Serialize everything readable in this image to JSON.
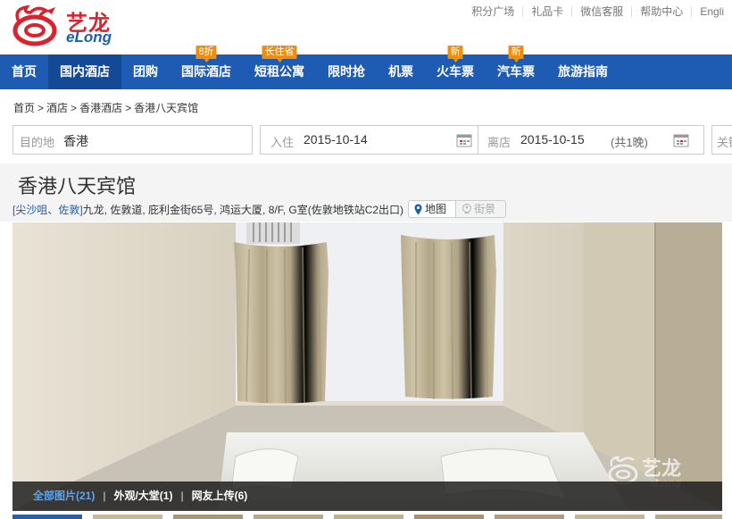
{
  "brand": {
    "name_cn": "艺龙",
    "name_en": "eLong"
  },
  "toplinks": [
    "积分广场",
    "礼品卡",
    "微信客服",
    "帮助中心",
    "Engli"
  ],
  "nav": [
    {
      "label": "首页"
    },
    {
      "label": "国内酒店",
      "active": true
    },
    {
      "label": "团购"
    },
    {
      "label": "国际酒店",
      "badge": "8折"
    },
    {
      "label": "短租公寓",
      "badge": "长住省"
    },
    {
      "label": "限时抢"
    },
    {
      "label": "机票"
    },
    {
      "label": "火车票",
      "badge": "新"
    },
    {
      "label": "汽车票",
      "badge": "新"
    },
    {
      "label": "旅游指南"
    }
  ],
  "breadcrumb": [
    "首页",
    "酒店",
    "香港酒店",
    "香港八天宾馆"
  ],
  "search": {
    "destination_label": "目的地",
    "destination_value": "香港",
    "checkin_label": "入住",
    "checkin_value": "2015-10-14",
    "checkout_label": "离店",
    "checkout_value": "2015-10-15",
    "nights": "(共1晚)",
    "keyword_label": "关键"
  },
  "hotel": {
    "title": "香港八天宾馆",
    "area": "[尖沙咀、佐敦]",
    "address": "九龙, 佐敦道, 庇利金街65号, 鸿运大厦, 8/F, G室(佐敦地铁站C2出口)",
    "map_label": "地图",
    "street_label": "街景"
  },
  "photo_tabs": {
    "all": "全部图片(21)",
    "exterior": "外观/大堂(1)",
    "user": "网友上传(6)"
  },
  "watermark": {
    "cn": "艺龙",
    "en": "eLong"
  },
  "colors": {
    "nav_bg": "#1e5cb3",
    "brand_red": "#d9232e",
    "badge": "#f08c0e",
    "link": "#1e5cb3"
  }
}
